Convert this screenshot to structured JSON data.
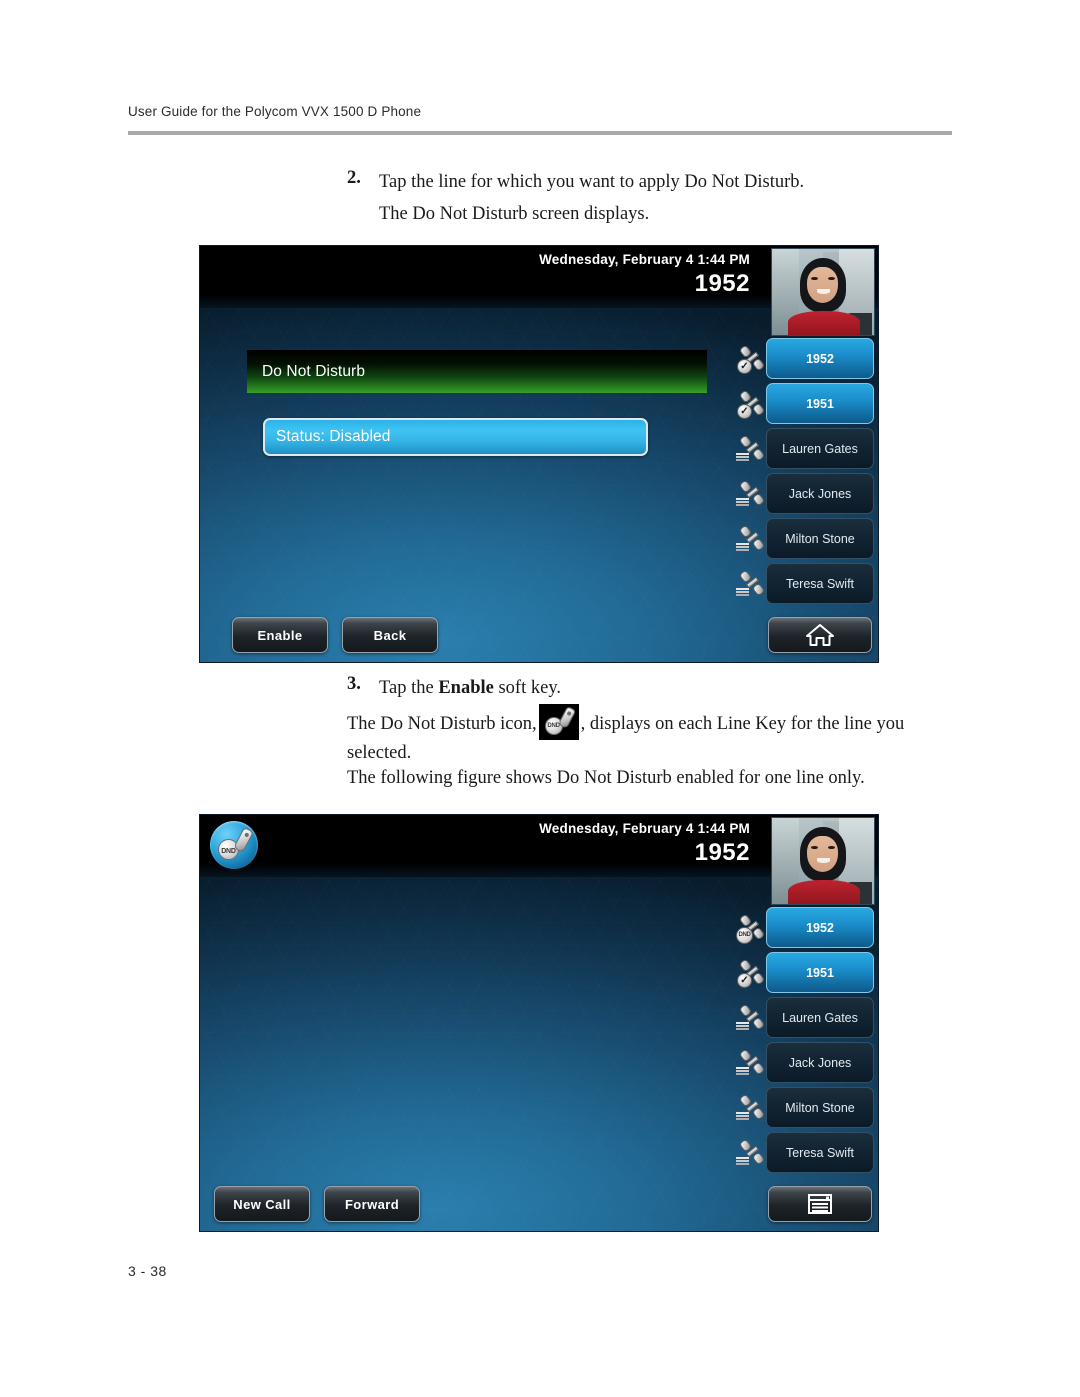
{
  "document": {
    "header": "User Guide for the Polycom VVX 1500 D Phone",
    "page_number": "3 - 38"
  },
  "steps": {
    "step2": {
      "number": "2.",
      "text": "Tap the line for which you want to apply Do Not Disturb.",
      "subtext": "The Do Not Disturb screen displays."
    },
    "step3": {
      "number": "3.",
      "text_before_bold": "Tap the ",
      "bold": "Enable",
      "text_after_bold": " soft key."
    },
    "icon_paragraph": {
      "before_icon": "The Do Not Disturb icon,",
      "after_icon": ", displays on each Line Key for the line you selected."
    },
    "following_paragraph": "The following figure shows Do Not Disturb enabled for one line only."
  },
  "colors": {
    "menu_title_green": "#3ca02a",
    "status_row_blue": "#36b4e6",
    "line_key_active_blue": "#1b8fcd",
    "screen_bg_blue": "#216a95",
    "status_bar_black": "#000000"
  },
  "phone1": {
    "name": "do-not-disturb-menu-screen",
    "status_bar": {
      "date": "Wednesday, February 4  1:44 PM",
      "extension": "1952"
    },
    "menu_title": "Do Not Disturb",
    "status_row": "Status: Disabled",
    "line_keys": [
      {
        "label": "1952",
        "state": "active",
        "badge": "check"
      },
      {
        "label": "1951",
        "state": "active",
        "badge": "check"
      },
      {
        "label": "Lauren Gates",
        "state": "idle",
        "badge": "none"
      },
      {
        "label": "Jack Jones",
        "state": "idle",
        "badge": "none"
      },
      {
        "label": "Milton Stone",
        "state": "idle",
        "badge": "none"
      },
      {
        "label": "Teresa Swift",
        "state": "idle",
        "badge": "none"
      }
    ],
    "soft_keys": [
      {
        "label": "Enable"
      },
      {
        "label": "Back"
      }
    ],
    "right_soft_key_icon": "home-icon"
  },
  "phone2": {
    "name": "idle-screen-with-dnd-enabled",
    "dnd_badge_label": "DND",
    "status_bar": {
      "date": "Wednesday, February 4  1:44 PM",
      "extension": "1952"
    },
    "line_keys": [
      {
        "label": "1952",
        "state": "active",
        "badge": "dnd"
      },
      {
        "label": "1951",
        "state": "active",
        "badge": "check"
      },
      {
        "label": "Lauren Gates",
        "state": "idle",
        "badge": "none"
      },
      {
        "label": "Jack Jones",
        "state": "idle",
        "badge": "none"
      },
      {
        "label": "Milton Stone",
        "state": "idle",
        "badge": "none"
      },
      {
        "label": "Teresa Swift",
        "state": "idle",
        "badge": "none"
      }
    ],
    "soft_keys": [
      {
        "label": "New Call"
      },
      {
        "label": "Forward"
      }
    ],
    "right_soft_key_icon": "window-menu-icon"
  }
}
